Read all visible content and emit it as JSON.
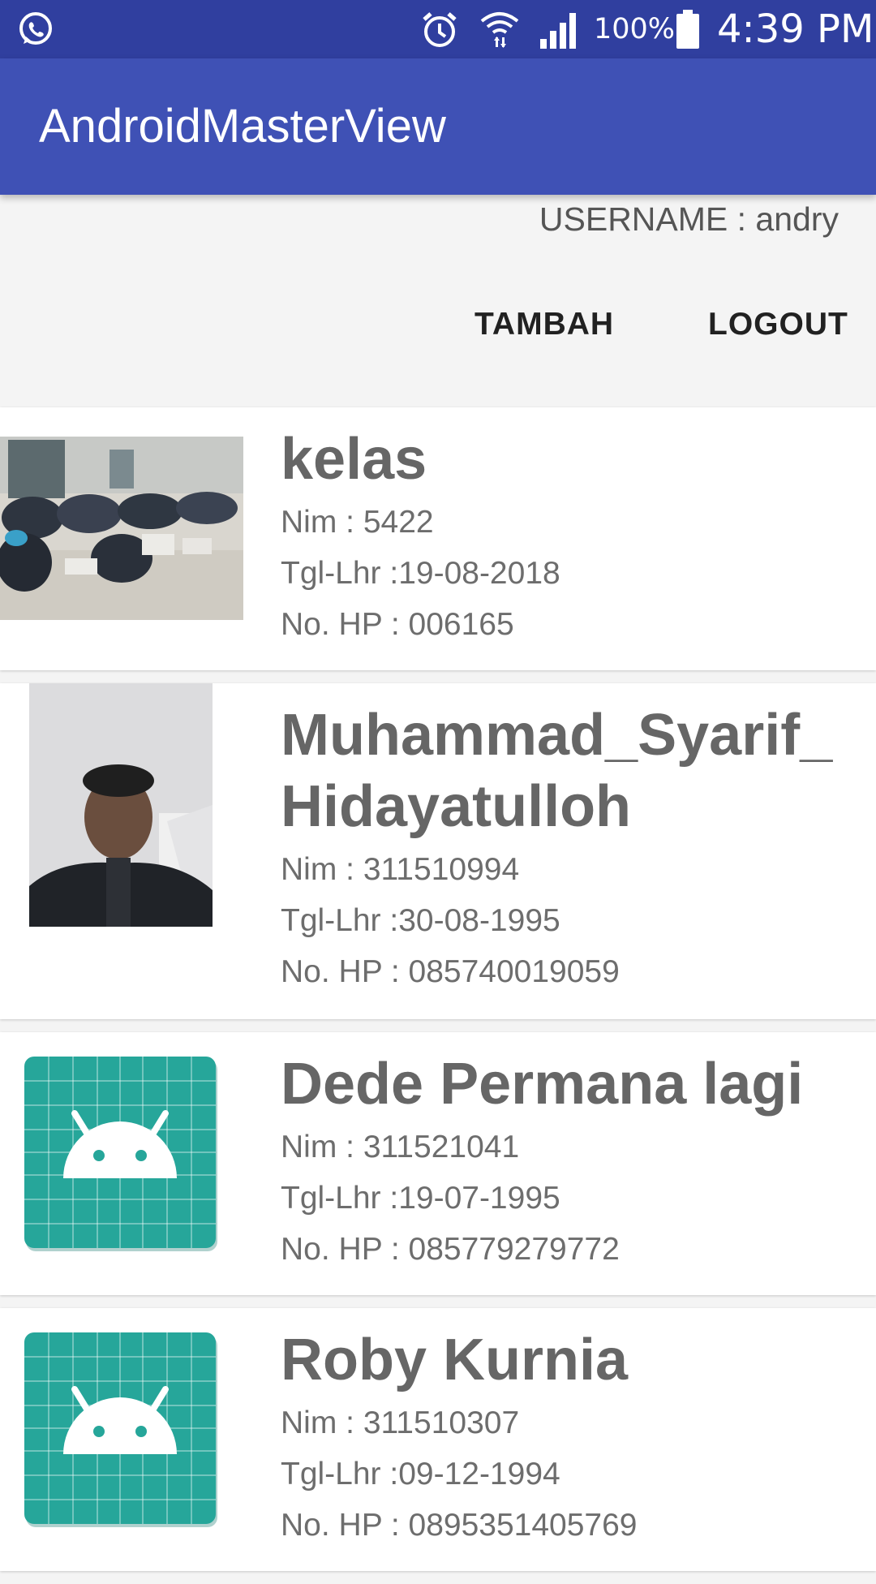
{
  "status_bar": {
    "battery_pct": "100%",
    "time": "4:39 PM",
    "icons": [
      "whatsapp-icon",
      "alarm-icon",
      "wifi-icon",
      "signal-icon",
      "battery-icon"
    ]
  },
  "app_bar": {
    "title": "AndroidMasterView"
  },
  "header": {
    "username_label": "USERNAME : andry",
    "add_button": "TAMBAH",
    "logout_button": "LOGOUT"
  },
  "students": [
    {
      "name": "kelas",
      "nim": "Nim : 5422",
      "birth": "Tgl-Lhr :19-08-2018",
      "phone": "No. HP : 006165",
      "photo": "classroom-photo"
    },
    {
      "name": "Muhammad_Syarif_Hidayatulloh",
      "nim": "Nim : 311510994",
      "birth": "Tgl-Lhr :30-08-1995",
      "phone": "No. HP : 085740019059",
      "photo": "selfie-photo"
    },
    {
      "name": "Dede Permana lagi",
      "nim": "Nim : 311521041",
      "birth": "Tgl-Lhr :19-07-1995",
      "phone": "No. HP : 085779279772",
      "photo": "android-placeholder-icon"
    },
    {
      "name": "Roby Kurnia",
      "nim": "Nim : 311510307",
      "birth": "Tgl-Lhr :09-12-1994",
      "phone": "No. HP : 0895351405769",
      "photo": "android-placeholder-icon"
    }
  ],
  "colors": {
    "status_bar": "#303f9f",
    "app_bar": "#3f51b5",
    "placeholder": "#26a69a"
  }
}
